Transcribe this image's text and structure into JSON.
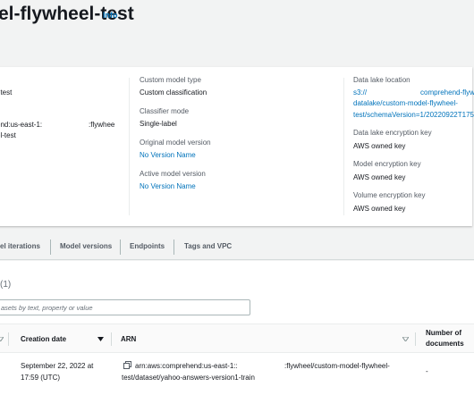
{
  "header": {
    "title": "el-flywheel-test",
    "info_link": "Info"
  },
  "details": {
    "left": {
      "name_value": "l-test",
      "arn_part1": "end:us-east-1:",
      "arn_part2": ":flywhee",
      "arn_part3": "el-test"
    },
    "middle": {
      "custom_model_type_label": "Custom model type",
      "custom_model_type_value": "Custom classification",
      "classifier_mode_label": "Classifier mode",
      "classifier_mode_value": "Single-label",
      "original_model_version_label": "Original model version",
      "original_model_version_value": "No Version Name",
      "active_model_version_label": "Active model version",
      "active_model_version_value": "No Version Name"
    },
    "right": {
      "data_lake_location_label": "Data lake location",
      "data_lake_line1a": "s3://",
      "data_lake_line1b": "comprehend-flyw",
      "data_lake_line2": "datalake/custom-model-flywheel-",
      "data_lake_line3": "test/schemaVersion=1/20220922T175",
      "data_lake_encryption_label": "Data lake encryption key",
      "data_lake_encryption_value": "AWS owned key",
      "model_encryption_label": "Model encryption key",
      "model_encryption_value": "AWS owned key",
      "volume_encryption_label": "Volume encryption key",
      "volume_encryption_value": "AWS owned key"
    }
  },
  "tabs": [
    {
      "label": "el iterations"
    },
    {
      "label": "Model versions"
    },
    {
      "label": "Endpoints"
    },
    {
      "label": "Tags and VPC"
    }
  ],
  "datasets": {
    "count": "(1)",
    "search_placeholder": "asets by text, property or value",
    "columns": {
      "creation_date": "Creation date",
      "arn": "ARN",
      "num_documents_line1": "Number of",
      "num_documents_line2": "documents"
    },
    "rows": [
      {
        "creation_line1": "September 22, 2022 at",
        "creation_line2": "17:59 (UTC)",
        "arn_part1": "arn:aws:comprehend:us-east-1::",
        "arn_part2": ":flywheel/custom-model-flywheel-",
        "arn_line2": "test/dataset/yahoo-answers-version1-train",
        "num_documents": "-"
      }
    ]
  },
  "icons": {
    "sort_down": "caret-down-icon",
    "sort_inactive": "sort-inactive-icon",
    "copy": "copy-icon"
  },
  "colors": {
    "link": "#0073bb",
    "background": "#f2f3f3"
  }
}
